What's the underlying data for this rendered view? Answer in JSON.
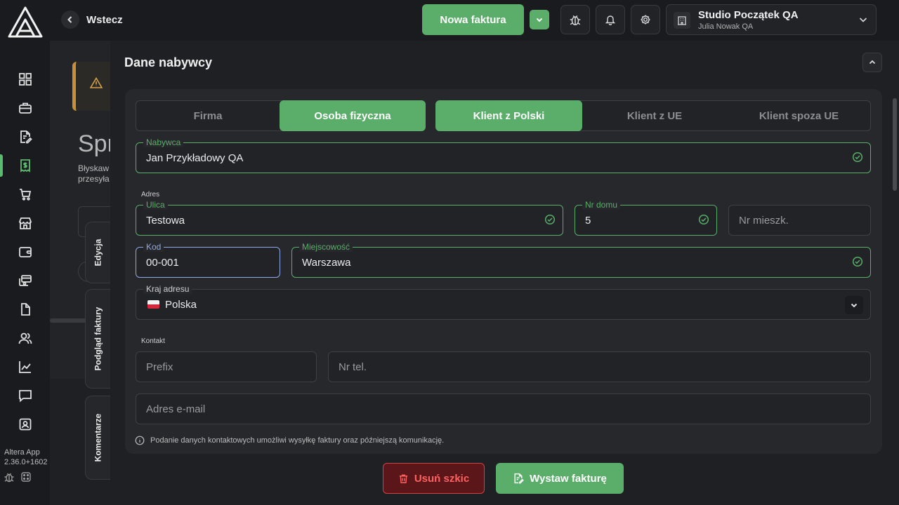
{
  "topbar": {
    "back_label": "Wstecz",
    "new_invoice_label": "Nowa faktura",
    "org_name": "Studio Początek QA",
    "org_user": "Julia Nowak QA"
  },
  "app": {
    "name": "Altera App",
    "version": "2.36.0+1602"
  },
  "background_page": {
    "title": "Spr",
    "subtitle_line1": "Błyskaw",
    "subtitle_line2": "przesyła"
  },
  "side_tabs": {
    "edit": "Edycja",
    "preview": "Podgląd faktury",
    "comments": "Komentarze"
  },
  "panel": {
    "title": "Dane nabywcy"
  },
  "buyer_type": {
    "options": [
      "Firma",
      "Osoba fizyczna"
    ],
    "selected": "Osoba fizyczna"
  },
  "client_origin": {
    "options": [
      "Klient z Polski",
      "Klient z UE",
      "Klient spoza UE"
    ],
    "selected": "Klient z Polski"
  },
  "form": {
    "buyer": {
      "label": "Nabywca",
      "value": "Jan Przykładowy QA"
    },
    "address_section": "Adres",
    "street": {
      "label": "Ulica",
      "value": "Testowa"
    },
    "house_no": {
      "label": "Nr domu",
      "value": "5"
    },
    "apartment_no": {
      "placeholder": "Nr mieszk."
    },
    "postal_code": {
      "label": "Kod",
      "value": "00-001"
    },
    "city": {
      "label": "Miejscowość",
      "value": "Warszawa"
    },
    "country": {
      "label": "Kraj adresu",
      "value": "Polska"
    },
    "contact_section": "Kontakt",
    "prefix": {
      "placeholder": "Prefix"
    },
    "phone": {
      "placeholder": "Nr tel."
    },
    "email": {
      "placeholder": "Adres e-mail"
    },
    "info": "Podanie danych kontaktowych umożliwi wysyłkę faktury oraz późniejszą komunikację."
  },
  "footer": {
    "delete_label": "Usuń szkic",
    "issue_label": "Wystaw fakturę"
  },
  "colors": {
    "accent": "#5aae6a",
    "danger": "#ff6161",
    "warning": "#c98f38",
    "focus": "#8fa9e8"
  }
}
